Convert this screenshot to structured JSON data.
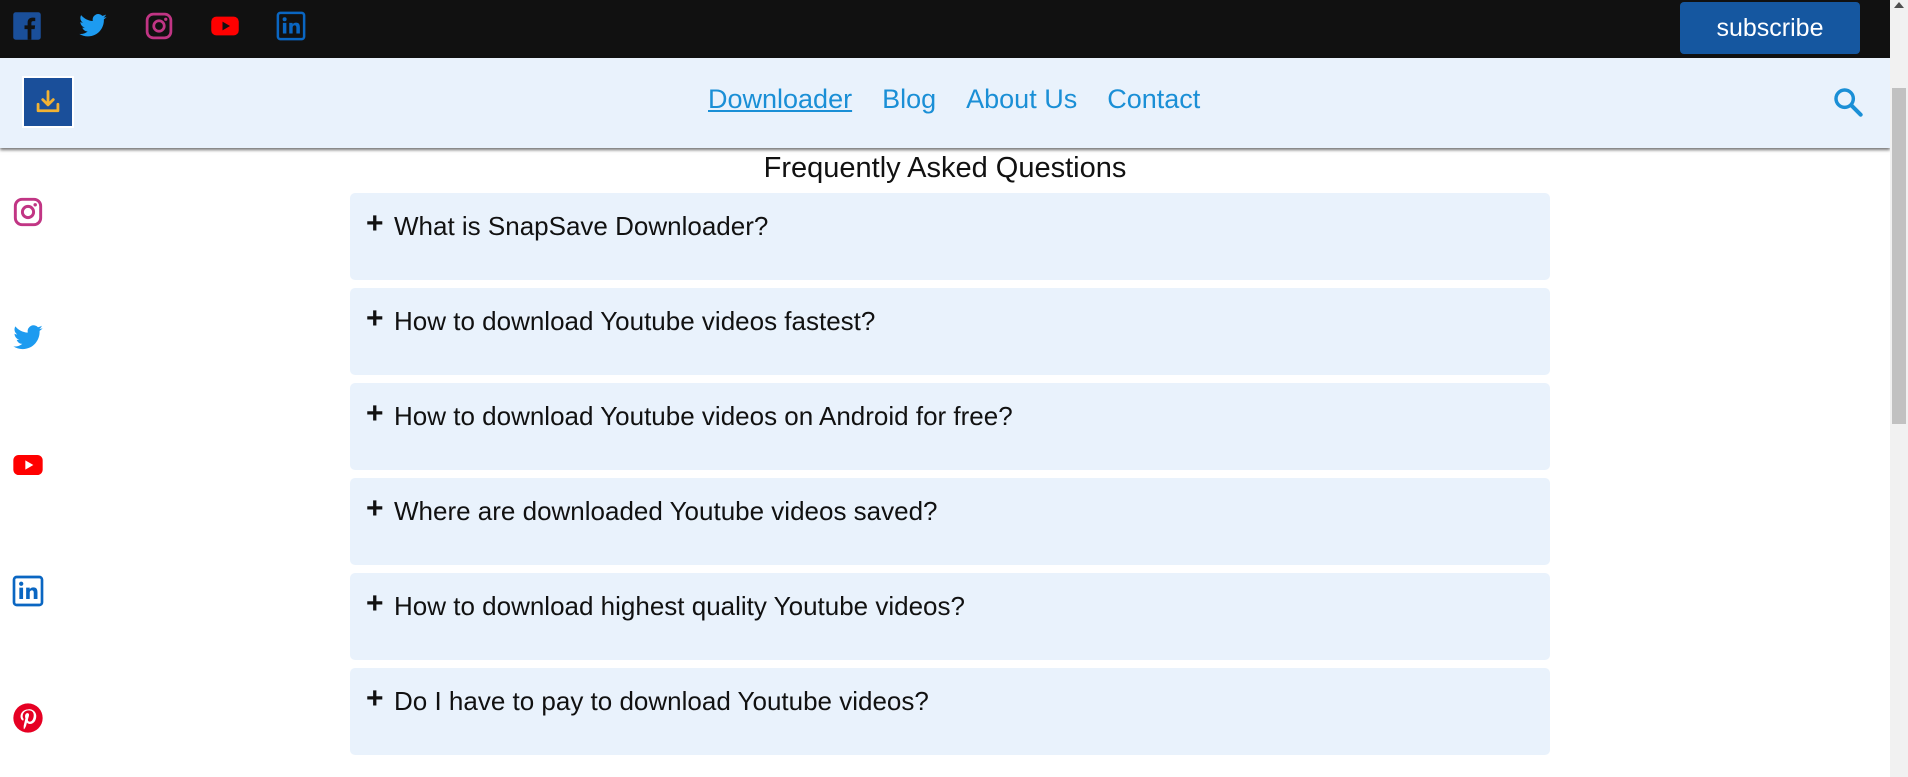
{
  "topbar": {
    "social_icons": [
      "facebook-icon",
      "twitter-icon",
      "instagram-icon",
      "youtube-icon",
      "linkedin-icon"
    ],
    "subscribe_label": "subscribe"
  },
  "header": {
    "logo_icon": "download-icon",
    "nav": [
      "Downloader",
      "Blog",
      "About Us",
      "Contact"
    ],
    "active_nav": "Downloader",
    "search_icon": "search-icon"
  },
  "faq": {
    "title": "Frequently Asked Questions",
    "items": [
      "What is SnapSave Downloader?",
      "How to download Youtube videos fastest?",
      "How to download Youtube videos on Android for free?",
      "Where are downloaded Youtube videos saved?",
      "How to download highest quality Youtube videos?",
      "Do I have to pay to download Youtube videos?"
    ]
  },
  "sidebar": {
    "icons": [
      "instagram-icon",
      "twitter-icon",
      "youtube-icon",
      "linkedin-icon",
      "pinterest-icon"
    ]
  },
  "colors": {
    "topbar_bg": "#111111",
    "header_bg": "#e9f2fc",
    "accent_blue": "#1557a0",
    "link_blue": "#1a8fd6",
    "facebook": "#1a4f9a",
    "twitter": "#1d9bf0",
    "instagram": "#c13584",
    "youtube": "#ff0000",
    "linkedin": "#0a66c2",
    "pinterest": "#e60023"
  }
}
